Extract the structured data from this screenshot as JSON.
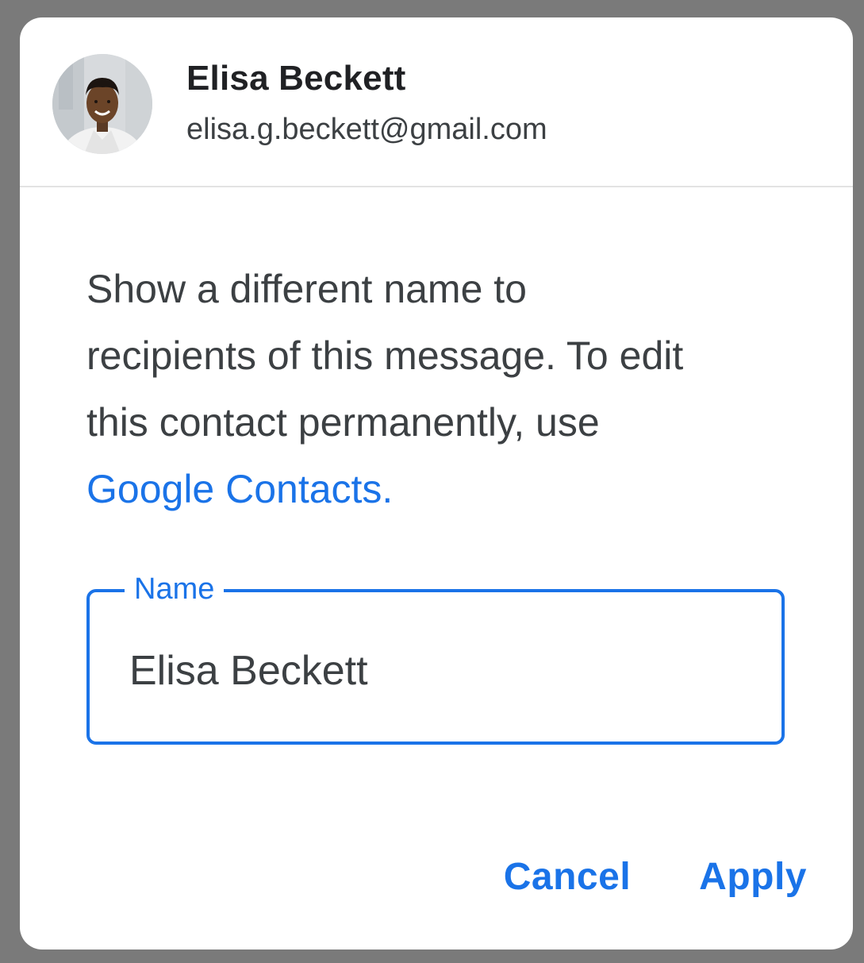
{
  "contact": {
    "name": "Elisa Beckett",
    "email": "elisa.g.beckett@gmail.com",
    "avatar_icon": "profile-photo"
  },
  "description": {
    "line1": "Show a different name to",
    "line2": "recipients of this message. To edit",
    "line3": "this contact permanently, use",
    "link_text": "Google Contacts."
  },
  "name_field": {
    "label": "Name",
    "value": "Elisa Beckett"
  },
  "actions": {
    "cancel_label": "Cancel",
    "apply_label": "Apply"
  },
  "colors": {
    "accent": "#1a73e8",
    "text_primary": "#202124",
    "text_secondary": "#3c4043",
    "backdrop": "#7a7a7a",
    "surface": "#ffffff"
  }
}
